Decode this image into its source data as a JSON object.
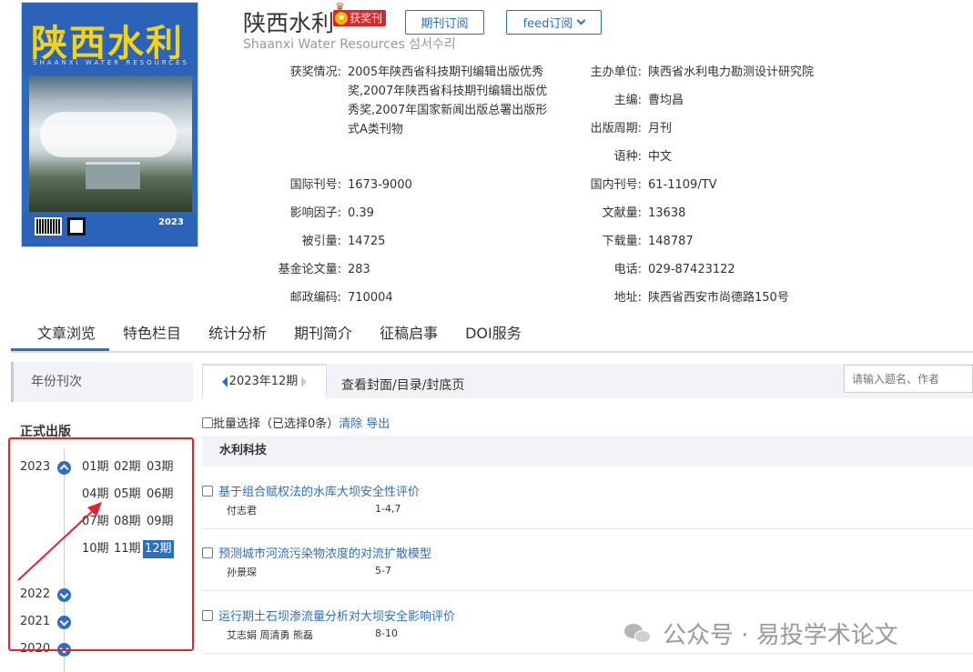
{
  "journal": {
    "title": "陕西水利",
    "badge": "获奖刊",
    "english": "Shaanxi Water Resources 섬서수리",
    "subscribe_btn": "期刊订阅",
    "feed_btn": "feed订阅",
    "cover": {
      "title": "陕西水利",
      "sub": "SHAANXI WATER RESOURCES",
      "year": "2023"
    }
  },
  "info": {
    "left": [
      {
        "label": "获奖情况:",
        "value": "2005年陕西省科技期刊编辑出版优秀奖,2007年陕西省科技期刊编辑出版优秀奖,2007年国家新闻出版总署出版形式A类刊物"
      },
      {
        "label": "国际刊号:",
        "value": "1673-9000"
      },
      {
        "label": "影响因子:",
        "value": "0.39"
      },
      {
        "label": "被引量:",
        "value": "14725"
      },
      {
        "label": "基金论文量:",
        "value": "283"
      },
      {
        "label": "邮政编码:",
        "value": "710004"
      }
    ],
    "right": [
      {
        "label": "主办单位:",
        "value": "陕西省水利电力勘测设计研究院"
      },
      {
        "label": "主编:",
        "value": "曹均昌"
      },
      {
        "label": "出版周期:",
        "value": "月刊"
      },
      {
        "label": "语种:",
        "value": "中文"
      },
      {
        "label": "国内刊号:",
        "value": "61-1109/TV"
      },
      {
        "label": "文献量:",
        "value": "13638"
      },
      {
        "label": "下载量:",
        "value": "148787"
      },
      {
        "label": "电话:",
        "value": "029-87423122"
      },
      {
        "label": "地址:",
        "value": "陕西省西安市尚德路150号"
      }
    ]
  },
  "tabs": [
    "文章浏览",
    "特色栏目",
    "统计分析",
    "期刊简介",
    "征稿启事",
    "DOI服务"
  ],
  "sidebar": {
    "header": "年份刊次",
    "section_title": "正式出版",
    "years": [
      "2023",
      "2022",
      "2021",
      "2020"
    ],
    "issues": [
      "01期",
      "02期",
      "03期",
      "04期",
      "05期",
      "06期",
      "07期",
      "08期",
      "09期",
      "10期",
      "11期",
      "12期"
    ],
    "selected_issue": "12期"
  },
  "main": {
    "current_issue": "2023年12期",
    "view_cover": "查看封面/目录/封底页",
    "search_placeholder": "请输入题名、作者",
    "batch_label": "批量选择（已选择0条）",
    "clear": "清除",
    "export": "导出",
    "section": "水利科技",
    "articles": [
      {
        "title": "基于组合赋权法的水库大坝安全性评价",
        "authors": "付志君",
        "pages": "1-4,7"
      },
      {
        "title": "预测城市河流污染物浓度的对流扩散模型",
        "authors": "孙景琛",
        "pages": "5-7"
      },
      {
        "title": "运行期土石坝渗流量分析对大坝安全影响评价",
        "authors": "艾志娟 周清勇 熊磊",
        "pages": "8-10"
      }
    ]
  },
  "watermark": "公众号 · 易投学术论文"
}
